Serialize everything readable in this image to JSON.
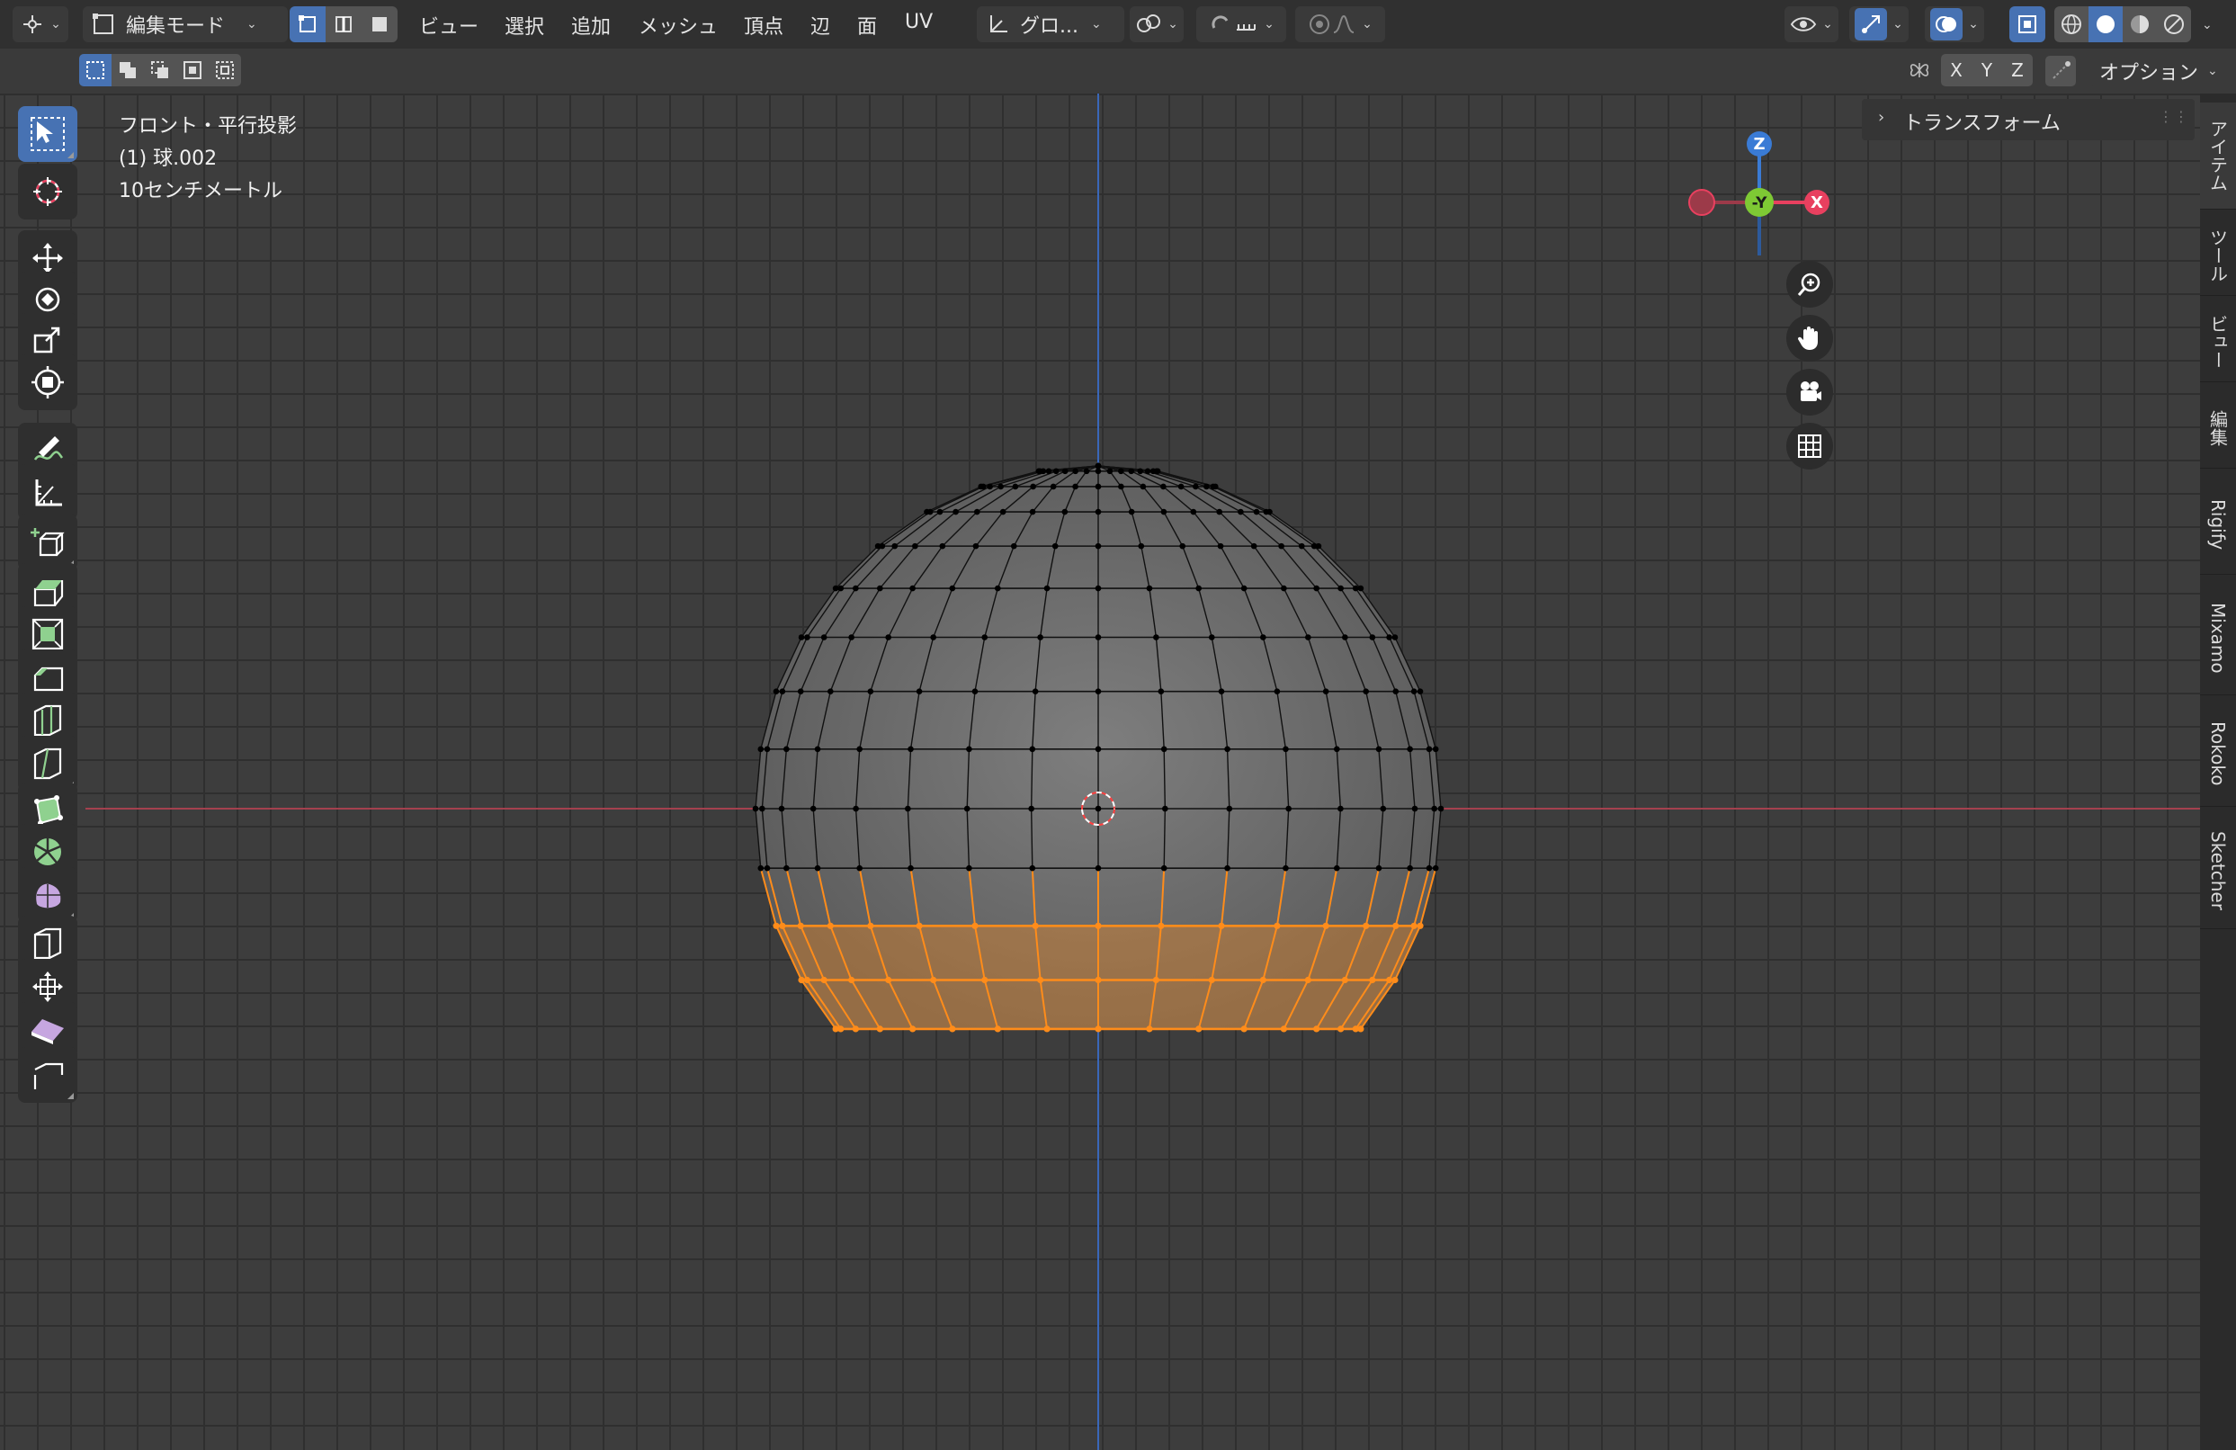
{
  "header": {
    "mode_label": "編集モード",
    "menus": [
      "ビュー",
      "選択",
      "追加",
      "メッシュ",
      "頂点",
      "辺",
      "面",
      "UV"
    ],
    "transform_orientation": "グロ...",
    "options_label": "オプション",
    "axes": [
      "X",
      "Y",
      "Z"
    ]
  },
  "viewport": {
    "view_name": "フロント・平行投影",
    "object_name": "(1) 球.002",
    "scale_text": "10センチメートル"
  },
  "gizmo": {
    "z": "Z",
    "y": "-Y",
    "x": "X"
  },
  "npanel": {
    "section": "トランスフォーム"
  },
  "side_tabs": [
    "アイテム",
    "ツール",
    "ビュー",
    "編集",
    "Rigify",
    "Mixamo",
    "Rokoko",
    "Sketcher"
  ],
  "colors": {
    "accent": "#4772b3",
    "selection": "#ff8c1a",
    "x_axis": "#e8405f",
    "y_axis": "#7ec934",
    "z_axis": "#3a7bd5"
  },
  "tools": [
    "select-box-icon",
    "cursor-icon",
    "move-icon",
    "rotate-icon",
    "scale-icon",
    "transform-icon",
    "annotate-icon",
    "measure-icon",
    "add-cube-icon",
    "extrude-icon",
    "inset-icon",
    "bevel-icon",
    "loop-cut-icon",
    "knife-icon",
    "poly-build-icon",
    "spin-icon",
    "smooth-icon",
    "edge-slide-icon",
    "shrink-fatten-icon",
    "shear-icon",
    "rip-icon"
  ]
}
